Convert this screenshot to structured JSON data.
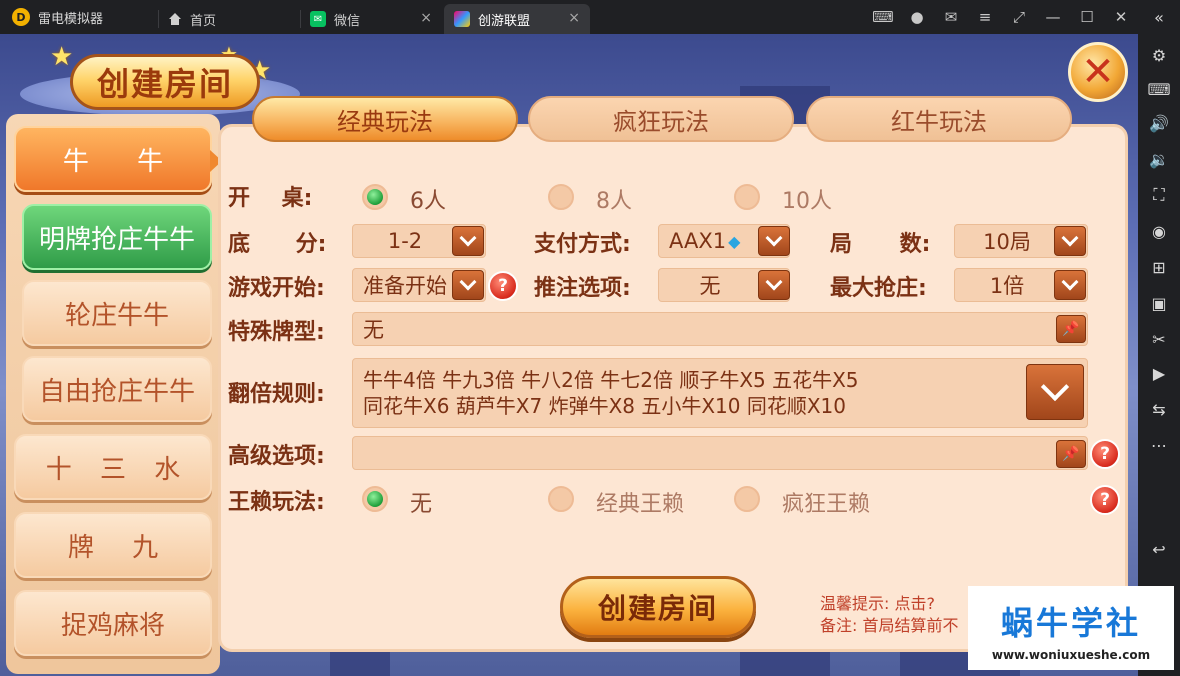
{
  "titlebar": {
    "app_name": "雷电模拟器",
    "tabs": [
      {
        "label": "首页",
        "icon": "home-icon"
      },
      {
        "label": "微信",
        "icon": "wechat-icon"
      },
      {
        "label": "创游联盟",
        "icon": "game-icon"
      }
    ],
    "close_glyph": "×"
  },
  "game": {
    "header_title": "创建房间",
    "close_glyph": "✕"
  },
  "menu": {
    "items": [
      "牛 牛",
      "明牌抢庄牛牛",
      "轮庄牛牛",
      "自由抢庄牛牛",
      "十 三 水",
      "牌 九",
      "捉鸡麻将"
    ]
  },
  "modes": [
    "经典玩法",
    "疯狂玩法",
    "红牛玩法"
  ],
  "form": {
    "table_label": "开 桌:",
    "table_options": [
      "6人",
      "8人",
      "10人"
    ],
    "table_selected": "6人",
    "base_label": "底 分:",
    "base_value": "1-2",
    "pay_label": "支付方式:",
    "pay_value": "AAX1",
    "rounds_label": "局 数:",
    "rounds_value": "10局",
    "start_label": "游戏开始:",
    "start_value": "准备开始",
    "bet_label": "推注选项:",
    "bet_value": "无",
    "banker_label": "最大抢庄:",
    "banker_value": "1倍",
    "special_label": "特殊牌型:",
    "special_value": "无",
    "double_label": "翻倍规则:",
    "double_line1": "牛牛4倍 牛九3倍 牛八2倍 牛七2倍 顺子牛X5 五花牛X5",
    "double_line2": "同花牛X6 葫芦牛X7 炸弹牛X8 五小牛X10 同花顺X10",
    "advanced_label": "高级选项:",
    "advanced_value": "",
    "wild_label": "王赖玩法:",
    "wild_options": [
      "无",
      "经典王赖",
      "疯狂王赖"
    ],
    "wild_selected": "无",
    "help_glyph": "?"
  },
  "create_button": "创建房间",
  "tips": [
    "温馨提示: 点击?",
    "备注: 首局结算前不"
  ],
  "watermark": {
    "title": "蜗牛学社",
    "url": "www.woniuxueshe.com"
  },
  "colors": {
    "accent_orange": "#f0782a",
    "selected_green": "#2f9c48",
    "panel_bg": "#fde6d3",
    "label_brown": "#7b3114"
  }
}
